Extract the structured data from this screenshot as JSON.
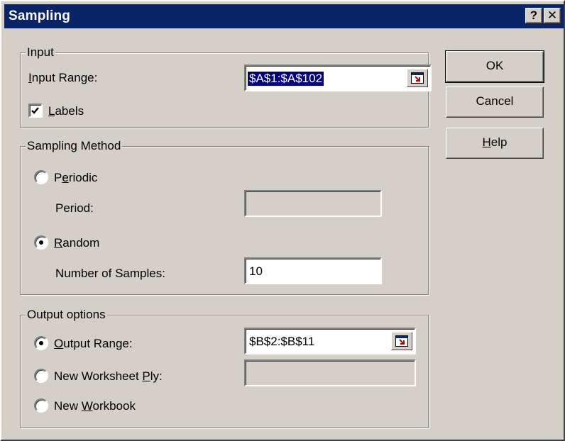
{
  "window": {
    "title": "Sampling",
    "help_glyph": "?",
    "close_glyph": "✕"
  },
  "input": {
    "legend": "Input",
    "range_label_u": "I",
    "range_label_rest": "nput Range:",
    "range_value": "$A$1:$A$102",
    "labels_checked": true,
    "labels_label_u": "L",
    "labels_label_rest": "abels"
  },
  "method": {
    "legend": "Sampling Method",
    "periodic_pre": "P",
    "periodic_u": "e",
    "periodic_post": "riodic",
    "periodic_selected": false,
    "period_label": "Period:",
    "period_value": "",
    "random_u": "R",
    "random_post": "andom",
    "random_selected": true,
    "samples_label": "Number of Samples:",
    "samples_value": "10"
  },
  "output": {
    "legend": "Output options",
    "range_u": "O",
    "range_post": "utput Range:",
    "range_selected": true,
    "range_value": "$B$2:$B$11",
    "worksheet_pre": "New Worksheet ",
    "worksheet_u": "P",
    "worksheet_post": "ly:",
    "worksheet_selected": false,
    "worksheet_value": "",
    "workbook_pre": "New ",
    "workbook_u": "W",
    "workbook_post": "orkbook",
    "workbook_selected": false
  },
  "buttons": {
    "ok": "OK",
    "cancel": "Cancel",
    "help_u": "H",
    "help_post": "elp"
  },
  "icons": {
    "help": "help-question-icon",
    "close": "close-x-icon",
    "ref_edit": "collapse-dialog-icon",
    "check": "checkmark-icon"
  },
  "colors": {
    "titlebar": "#0a246a",
    "face": "#d4d0c8",
    "selection": "#000080"
  }
}
